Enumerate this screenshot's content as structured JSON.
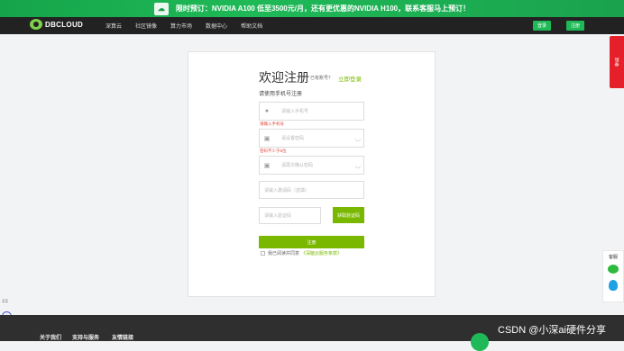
{
  "promo": {
    "text": "限时预订：NVIDIA A100 低至3500元/月，还有更优惠的NVIDIA H100，联系客服马上预订！",
    "icon": "cloud-gift-icon"
  },
  "header": {
    "logo_text": "DBCLOUD",
    "nav": [
      "深算云",
      "社区镜像",
      "算力市场",
      "数据中心",
      "帮助文档"
    ],
    "login_btn": "登录",
    "register_btn": "注册"
  },
  "form": {
    "title": "欢迎注册",
    "have_account": "已有账号？",
    "login_link": "立即登录",
    "subtitle": "请使用手机号注册",
    "phone_placeholder": "请输入手机号",
    "phone_error": "请输入手机号",
    "password_placeholder": "请设置密码",
    "password_error": "密码不少于6位",
    "confirm_placeholder": "请再次确认密码",
    "invite_placeholder": "请输入邀请码（选填）",
    "code_placeholder": "请输入验证码",
    "get_code_btn": "获取验证码",
    "submit_btn": "注册",
    "agree_prefix": "我已阅读并同意",
    "agree_link": "《深脑云服务条款》"
  },
  "side": {
    "tab_text": "领券",
    "service_label": "客服"
  },
  "footer": {
    "links": [
      "关于我们",
      "支持与服务",
      "友情链接"
    ]
  },
  "watermark": "CSDN @小深ai硬件分享",
  "colors": {
    "accent": "#7ab800",
    "brand_green": "#1fb957",
    "error": "#e0463c"
  }
}
